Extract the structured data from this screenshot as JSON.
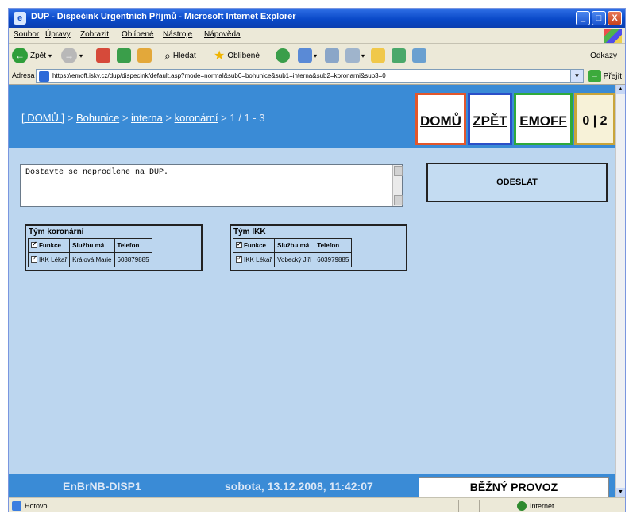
{
  "window": {
    "title": "DUP - Dispečink Urgentních Příjmů - Microsoft Internet Explorer",
    "controls": {
      "minimize": "_",
      "maximize": "□",
      "close": "X"
    }
  },
  "menu": [
    "Soubor",
    "Úpravy",
    "Zobrazit",
    "Oblíbené",
    "Nástroje",
    "Nápověda"
  ],
  "toolbar": {
    "back": "Zpět",
    "search": "Hledat",
    "favorites": "Oblíbené",
    "links": "Odkazy"
  },
  "address": {
    "label": "Adresa",
    "url": "https://emoff.iskv.cz/dup/dispecink/default.asp?mode=normal&sub0=bohunice&sub1=interna&sub2=koronarni&sub3=0",
    "go": "Přejít"
  },
  "page": {
    "breadcrumb": {
      "home": "[ DOMŮ ]",
      "sep": " > ",
      "level1": "Bohunice",
      "level2": "interna",
      "level3": "koronární",
      "position": "1 / 1 - 3"
    },
    "nav": {
      "home": "DOMŮ",
      "back": "ZPĚT",
      "emoff": "EMOFF",
      "counter": "0 | 2"
    },
    "message": "Dostavte se neprodlene na DUP.",
    "send": "ODESLAT",
    "teams": [
      {
        "title": "Tým koronární",
        "headers": [
          "Funkce",
          "Službu má",
          "Telefon"
        ],
        "rows": [
          {
            "role": "IKK Lékař",
            "person": "Králová Marie",
            "phone": "603879885"
          }
        ]
      },
      {
        "title": "Tým IKK",
        "headers": [
          "Funkce",
          "Službu má",
          "Telefon"
        ],
        "rows": [
          {
            "role": "IKK Lékař",
            "person": "Vobecký Jiří",
            "phone": "603979885"
          }
        ]
      }
    ],
    "footer": {
      "station": "EnBrNB-DISP1",
      "datetime": "sobota, 13.12.2008, 11:42:07",
      "mode": "BĚŽNÝ PROVOZ"
    }
  },
  "status": {
    "left": "Hotovo",
    "zone": "Internet"
  }
}
